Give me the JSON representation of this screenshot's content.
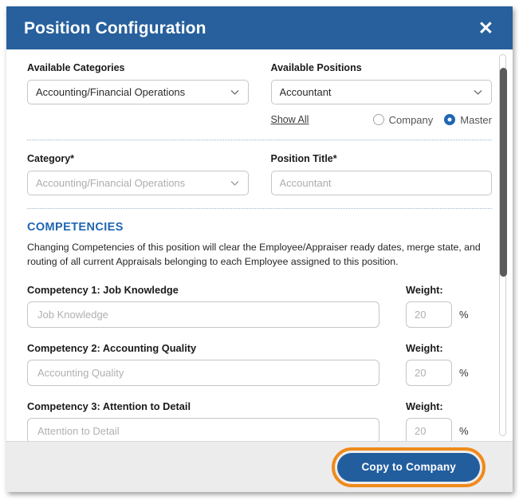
{
  "dialog": {
    "title": "Position Configuration",
    "close_icon": "close-icon"
  },
  "available": {
    "categories_label": "Available Categories",
    "categories_value": "Accounting/Financial Operations",
    "positions_label": "Available Positions",
    "positions_value": "Accountant",
    "show_all_label": "Show All",
    "scope_options": [
      {
        "label": "Company",
        "selected": false
      },
      {
        "label": "Master",
        "selected": true
      }
    ]
  },
  "details": {
    "category_label": "Category*",
    "category_placeholder": "Accounting/Financial Operations",
    "position_title_label": "Position Title*",
    "position_title_placeholder": "Accountant"
  },
  "competencies": {
    "section_title": "COMPETENCIES",
    "note": "Changing Competencies of this position will clear the Employee/Appraiser ready dates, merge state, and routing of all current Appraisals belonging to each Employee assigned to this position.",
    "weight_label": "Weight:",
    "percent_symbol": "%",
    "items": [
      {
        "heading": "Competency 1: Job Knowledge",
        "placeholder": "Job Knowledge",
        "weight": "20"
      },
      {
        "heading": "Competency 2: Accounting Quality",
        "placeholder": "Accounting Quality",
        "weight": "20"
      },
      {
        "heading": "Competency 3: Attention to Detail",
        "placeholder": "Attention to Detail",
        "weight": "20"
      }
    ]
  },
  "footer": {
    "primary_button_label": "Copy to Company"
  },
  "colors": {
    "header_blue": "#27609d",
    "accent_blue": "#1f66b3",
    "highlight_orange": "#f08a1b",
    "footer_grey": "#ececec"
  }
}
